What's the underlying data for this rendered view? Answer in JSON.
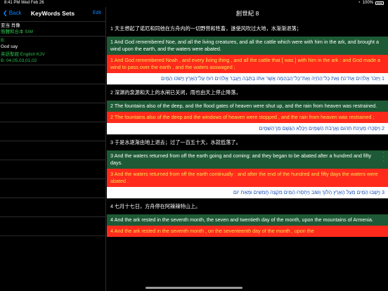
{
  "status_bar": {
    "time": "8:41 PM",
    "date": "Wed Feb 26",
    "battery": "100%"
  },
  "sidebar": {
    "back_label": "Back",
    "title": "KeyWords Sets",
    "edit_label": "Edit",
    "items": [
      {
        "title": "亚当 肖像",
        "subtitle": "簡體和合本 SIM"
      },
      {
        "title": "B:",
        "subtitle": "God say",
        "extra": "英語聖經 English KJV",
        "ref": "B: 04,05,03,01,02"
      }
    ]
  },
  "main": {
    "title": "創世紀 8",
    "verses": [
      {
        "type": "cn",
        "text": "1 天主想起了诺厄和同他在方舟内的一切野兽和牲畜，遂使风吹过大地，水渐渐退落；"
      },
      {
        "type": "en",
        "text": "1 And God remembered Noe, and all the living creatures, and all the cattle which were with him in the ark, and brought a wind upon the earth, and the waters were abated."
      },
      {
        "type": "en2",
        "text": "1 And God remembered Noah , and every living thing , and all the cattle that [ was ] with him in the ark : and God made a wind to pass over the earth , and the waters asswaged ;"
      },
      {
        "type": "he",
        "text": "1 וַיִּזְכֹּר אֱלֹהִים אֶת־נֹחַ וְאֵת כָּל־הַחַיָּה וְאֶת־כָּל־הַבְּהֵמָה אֲשֶׁר אִתּוֹ בַּתֵּבָה וַיַּעֲבֵר אֱלֹהִים רוּחַ עַל־הָאָרֶץ וַיָּשֹׁכּוּ הַמָּיִם׃"
      },
      {
        "type": "cn",
        "text": "2 深渊的泉源和天上的水闸已关闭，雨也由天上停止降落，"
      },
      {
        "type": "en",
        "text": "2 The fountains also of the deep, and the flood gates of heaven were shut up, and the rain from heaven was restrained."
      },
      {
        "type": "en2",
        "text": "2 The fountains also of the deep and the windows of heaven were stopped , and the rain from heaven was restrained ;"
      },
      {
        "type": "he",
        "text": "2 וַיִּסָּכְרוּ מַעְיְנֹת תְּהוֹם וַאֲרֻבֹּת הַשָּׁמָיִם וַיִּכָּלֵא הַגֶּשֶׁם מִן־הַשָּׁמָיִם׃"
      },
      {
        "type": "cn",
        "text": "3 于是水逐渐由地上退去；过了一百五十天，水就低落了。"
      },
      {
        "type": "en",
        "text": "3 And the waters returned from off the earth going and coming: and they began to be abated after a hundred and fifty days."
      },
      {
        "type": "en2",
        "text": "3 And the waters returned from off the earth continually : and after the end of the hundred and fifty days the waters were abated ."
      },
      {
        "type": "he",
        "text": "3 וַיָּשֻׁבוּ הַמַּיִם מֵעַל הָאָרֶץ הָלוֹךְ וָשׁוֹב וַיַּחְסְרוּ הַמַּיִם מִקְצֵה חֲמִשִּׁים וּמְאַת יוֹם׃"
      },
      {
        "type": "cn",
        "text": "4 七月十七日，方舟停在阿辣辣特山上。"
      },
      {
        "type": "en",
        "text": "4 And the ark rested in the seventh month, the seven and twentieth day of the month, upon the mountains of Armenia."
      },
      {
        "type": "en2",
        "text": "4 And the ark rested in the seventh month , on the seventeenth day of the month , upon the"
      }
    ]
  }
}
